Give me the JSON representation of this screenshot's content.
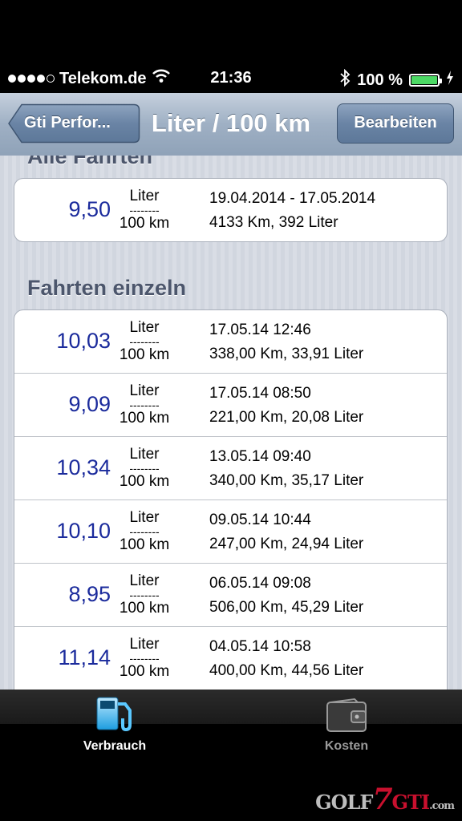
{
  "status": {
    "carrier": "Telekom.de",
    "time": "21:36",
    "battery": "100 %",
    "battery_level": 1.0
  },
  "navbar": {
    "back_label": "Gti Perfor...",
    "title": "Liter / 100 km",
    "edit_label": "Bearbeiten"
  },
  "sections": {
    "all_title": "Alle Fahrten",
    "single_title": "Fahrten einzeln"
  },
  "unit": {
    "top": "Liter",
    "dash": "--------",
    "bottom": "100 km"
  },
  "all_trips": {
    "value": "9,50",
    "range": "19.04.2014 - 17.05.2014",
    "summary": "4133 Km, 392 Liter"
  },
  "trips": [
    {
      "value": "10,03",
      "date": "17.05.14 12:46",
      "summary": "338,00 Km, 33,91 Liter"
    },
    {
      "value": "9,09",
      "date": "17.05.14 08:50",
      "summary": "221,00 Km, 20,08 Liter"
    },
    {
      "value": "10,34",
      "date": "13.05.14 09:40",
      "summary": "340,00 Km, 35,17 Liter"
    },
    {
      "value": "10,10",
      "date": "09.05.14 10:44",
      "summary": "247,00 Km, 24,94 Liter"
    },
    {
      "value": "8,95",
      "date": "06.05.14 09:08",
      "summary": "506,00 Km, 45,29 Liter"
    },
    {
      "value": "11,14",
      "date": "04.05.14 10:58",
      "summary": "400,00 Km, 44,56 Liter"
    }
  ],
  "tabbar": {
    "tabs": [
      {
        "label": "Verbrauch",
        "icon": "fuel-pump-icon",
        "active": true
      },
      {
        "label": "Kosten",
        "icon": "wallet-icon",
        "active": false
      }
    ]
  },
  "watermark": {
    "golf": "GOLF",
    "seven": "7",
    "gti": "GTI",
    "com": ".com"
  },
  "colors": {
    "value_blue": "#1b2b9c",
    "section_text": "#4c566c",
    "battery_green": "#4cd964",
    "tab_active_icon": "#5ac8ff"
  }
}
